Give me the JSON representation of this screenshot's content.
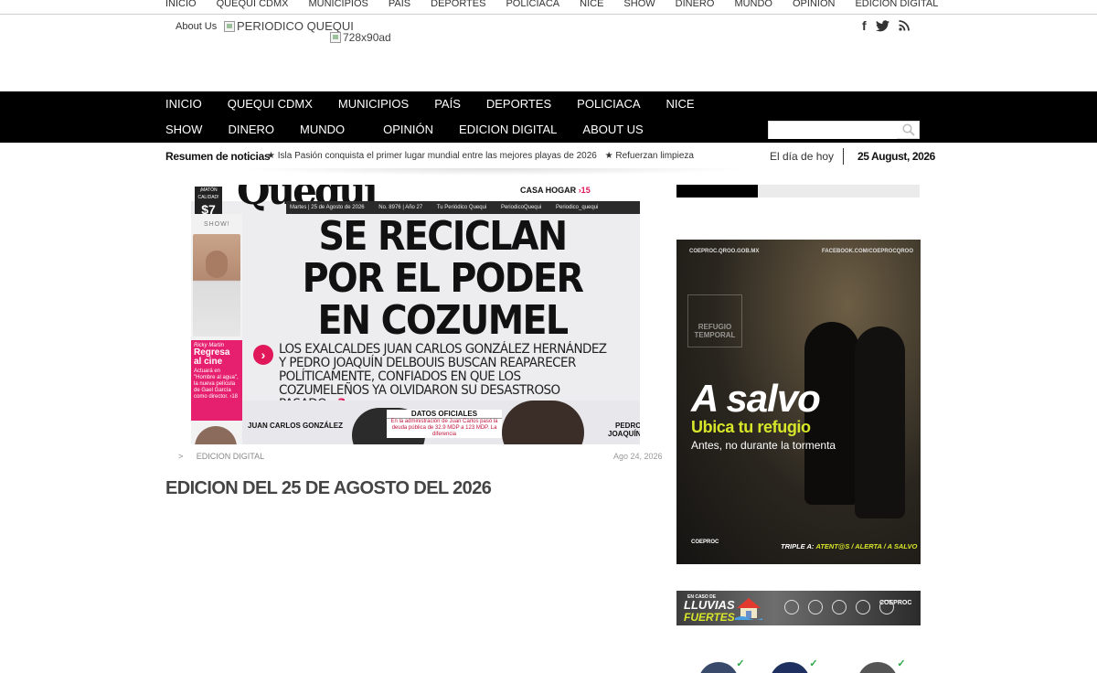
{
  "top_menu": [
    "INICIO",
    "QUEQUI CDMX",
    "MUNICIPIOS",
    "PAIS",
    "DEPORTES",
    "POLICIACA",
    "NICE",
    "SHOW",
    "DINERO",
    "MUNDO",
    "OPINION",
    "EDICION DIGITAL"
  ],
  "header": {
    "about_label": "About Us",
    "logo_alt": "PERIODICO QUEQUI",
    "ad_alt": "728x90ad",
    "social_icons": [
      "facebook-icon",
      "twitter-icon",
      "rss-icon"
    ]
  },
  "main_nav": [
    "INICIO",
    "QUEQUI CDMX",
    "MUNICIPIOS",
    "PAÍS",
    "DEPORTES",
    "POLICIACA",
    "NICE",
    "SHOW",
    "DINERO",
    "MUNDO",
    "OPINIÓN",
    "EDICION DIGITAL",
    "ABOUT US"
  ],
  "search": {
    "placeholder": ""
  },
  "ticker": {
    "label": "Resumen de noticias",
    "items": [
      "★ Isla Pasión conquista el primer lugar mundial entre las mejores playas de 2026",
      "★ Refuerzan limpieza"
    ],
    "today_label": "El día de hoy",
    "today_date": "25 August, 2026"
  },
  "cover": {
    "masthead": "Quequi",
    "price_top": "¡MATÓN CALIDAD!",
    "price": "$7",
    "casa_hogar": "CASA HOGAR",
    "casa_hogar_page": "›15",
    "strip": [
      "Martes | 25 de Agosto de 2026",
      "No. 8976 | Año 27",
      "Tu Periódico Quequi",
      "PeriodicoQuequi",
      "Periodico_quequi"
    ],
    "show_label": "SHOW!",
    "sidebar_name": "Ricky Martin",
    "sidebar_title": "Regresa al cine",
    "sidebar_text": "Actuará en \"Hombre al agua\", la nueva película de Gael García como director. ›18",
    "headline": [
      "SE RECICLAN",
      "POR EL PODER",
      "EN COZUMEL"
    ],
    "subhead": "LOS EXALCALDES JUAN CARLOS GONZÁLEZ HERNÁNDEZ Y PEDRO JOAQUÍN DELBOUIS BUSCAN REAPARECER POLÍTICAMENTE, CONFIADOS EN QUE LOS COZUMELEÑOS YA OLVIDARON SU DESASTROSO PASADO.",
    "subhead_page": "›3",
    "datos_title": "DATOS OFICIALES",
    "datos_text": "En la administración de Juan Carlos pasó la deuda pública de 32.9 MDP a 123 MDP. La diferencia",
    "name_left": "JUAN CARLOS GONZÁLEZ",
    "name_right": "PEDRO JOAQUÍN"
  },
  "post": {
    "category_prefix": ">",
    "category": "EDICION DIGITAL",
    "date": "Ago 24, 2026",
    "title": "EDICION DEL 25 DE AGOSTO DEL 2026"
  },
  "promo": {
    "site": "COEPROC.QROO.GOB.MX",
    "facebook": "FACEBOOK.COM/COEPROCQROO",
    "sign": "REFUGIO TEMPORAL",
    "title": "A salvo",
    "subtitle": "Ubica tu refugio",
    "note": "Antes, no durante la tormenta",
    "footer_logo": "COEPROC",
    "footer_prefix": "TRIPLE A:",
    "footer_highlight": "ATENT@S / ALERTA / A SALVO"
  },
  "lluvias": {
    "small": "EN CASO DE",
    "big1": "LLUVIAS",
    "big2": "FUERTES",
    "org": "COEPROC"
  },
  "colors": {
    "nav_bg": "#000000",
    "accent_pink": "#e0185a",
    "promo_yellow": "#d8e62a",
    "verified_green": "#2aa845"
  }
}
